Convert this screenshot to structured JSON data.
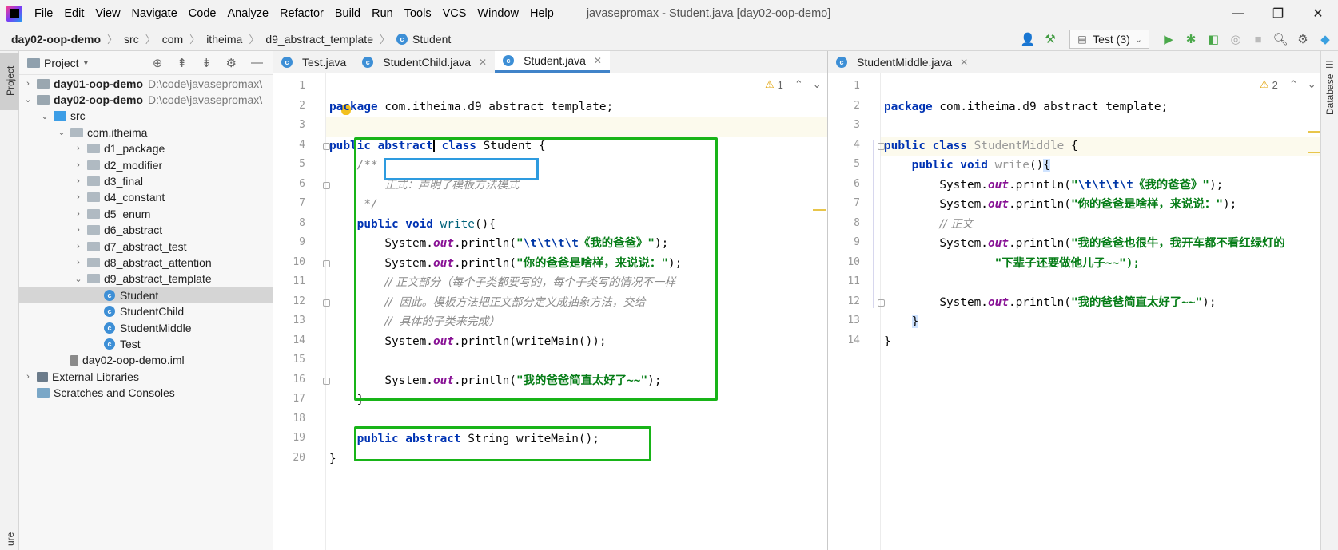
{
  "app": {
    "menus": [
      "File",
      "Edit",
      "View",
      "Navigate",
      "Code",
      "Analyze",
      "Refactor",
      "Build",
      "Run",
      "Tools",
      "VCS",
      "Window",
      "Help"
    ],
    "window_title": "javasepromax - Student.java [day02-oop-demo]",
    "controls": [
      "—",
      "❐",
      "✕"
    ]
  },
  "breadcrumb": [
    "day02-oop-demo",
    "src",
    "com",
    "itheima",
    "d9_abstract_template",
    "Student"
  ],
  "toolbar": {
    "run_config": "Test (3)"
  },
  "left_strip": {
    "project_tab": "Project",
    "structure_tab": "ure"
  },
  "right_strip": {
    "database_tab": "Database"
  },
  "project": {
    "header": "Project",
    "tree": [
      {
        "label": "day01-oop-demo",
        "path": "D:\\code\\javasepromax\\",
        "bold": true,
        "arrow": "›",
        "indent": 0,
        "icon": "folder"
      },
      {
        "label": "day02-oop-demo",
        "path": "D:\\code\\javasepromax\\",
        "bold": true,
        "arrow": "⌄",
        "indent": 0,
        "icon": "folder"
      },
      {
        "label": "src",
        "arrow": "⌄",
        "indent": 1,
        "icon": "blue"
      },
      {
        "label": "com.itheima",
        "arrow": "⌄",
        "indent": 2,
        "icon": "pkg"
      },
      {
        "label": "d1_package",
        "arrow": "›",
        "indent": 3,
        "icon": "pkg"
      },
      {
        "label": "d2_modifier",
        "arrow": "›",
        "indent": 3,
        "icon": "pkg"
      },
      {
        "label": "d3_final",
        "arrow": "›",
        "indent": 3,
        "icon": "pkg"
      },
      {
        "label": "d4_constant",
        "arrow": "›",
        "indent": 3,
        "icon": "pkg"
      },
      {
        "label": "d5_enum",
        "arrow": "›",
        "indent": 3,
        "icon": "pkg"
      },
      {
        "label": "d6_abstract",
        "arrow": "›",
        "indent": 3,
        "icon": "pkg"
      },
      {
        "label": "d7_abstract_test",
        "arrow": "›",
        "indent": 3,
        "icon": "pkg"
      },
      {
        "label": "d8_abstract_attention",
        "arrow": "›",
        "indent": 3,
        "icon": "pkg"
      },
      {
        "label": "d9_abstract_template",
        "arrow": "⌄",
        "indent": 3,
        "icon": "pkg"
      },
      {
        "label": "Student",
        "arrow": "",
        "indent": 4,
        "icon": "class",
        "selected": true
      },
      {
        "label": "StudentChild",
        "arrow": "",
        "indent": 4,
        "icon": "class"
      },
      {
        "label": "StudentMiddle",
        "arrow": "",
        "indent": 4,
        "icon": "class"
      },
      {
        "label": "Test",
        "arrow": "",
        "indent": 4,
        "icon": "class"
      },
      {
        "label": "day02-oop-demo.iml",
        "arrow": "",
        "indent": 2,
        "icon": "file"
      },
      {
        "label": "External Libraries",
        "arrow": "›",
        "indent": 0,
        "icon": "lib"
      },
      {
        "label": "Scratches and Consoles",
        "arrow": "",
        "indent": 0,
        "icon": "scratch"
      }
    ]
  },
  "left_editor": {
    "tabs": [
      {
        "label": "Test.java",
        "active": false,
        "close": false
      },
      {
        "label": "StudentChild.java",
        "active": false,
        "close": true
      },
      {
        "label": "Student.java",
        "active": true,
        "close": true
      }
    ],
    "warning": "1",
    "line_numbers": [
      "1",
      "2",
      "3",
      "4",
      "5",
      "6",
      "7",
      "8",
      "9",
      "10",
      "11",
      "12",
      "13",
      "14",
      "15",
      "16",
      "17",
      "18",
      "19",
      "20"
    ]
  },
  "right_editor": {
    "tabs": [
      {
        "label": "StudentMiddle.java",
        "active": false,
        "close": true
      }
    ],
    "warning": "2",
    "line_numbers": [
      "1",
      "2",
      "3",
      "4",
      "5",
      "6",
      "7",
      "8",
      "9",
      "10",
      "11",
      "12",
      "13",
      "14"
    ]
  },
  "code_text": {
    "pkg_left": "com.itheima.d9_abstract_template;",
    "class_name": "Student",
    "javadoc_open": "/**",
    "javadoc_body": "正式：声明了模板方法模式",
    "javadoc_close": "*/",
    "write": "write",
    "sysout": "System.",
    "out": "out",
    "println": ".println(",
    "tabs_esc": "\\t\\t\\t\\t",
    "s_title": "《我的爸爸》",
    "s_how": "你的爸爸是啥样，来说说：",
    "c1": "// 正文部分（每个子类都要写的，每个子类写的情况不一样",
    "c2": "//  因此。模板方法把正文部分定义成抽象方法，交给",
    "c3": "//  具体的子类来完成）",
    "call_main": "writeMain());",
    "s_end": "我的爸爸简直太好了~~",
    "abstract_decl": "String writeMain();",
    "class_middle": "StudentMiddle",
    "c_body": "// 正文",
    "s_long": "我的爸爸也很牛，我开车都不看红绿灯的",
    "s_cont": "\"下辈子还要做他儿子~~\");"
  }
}
